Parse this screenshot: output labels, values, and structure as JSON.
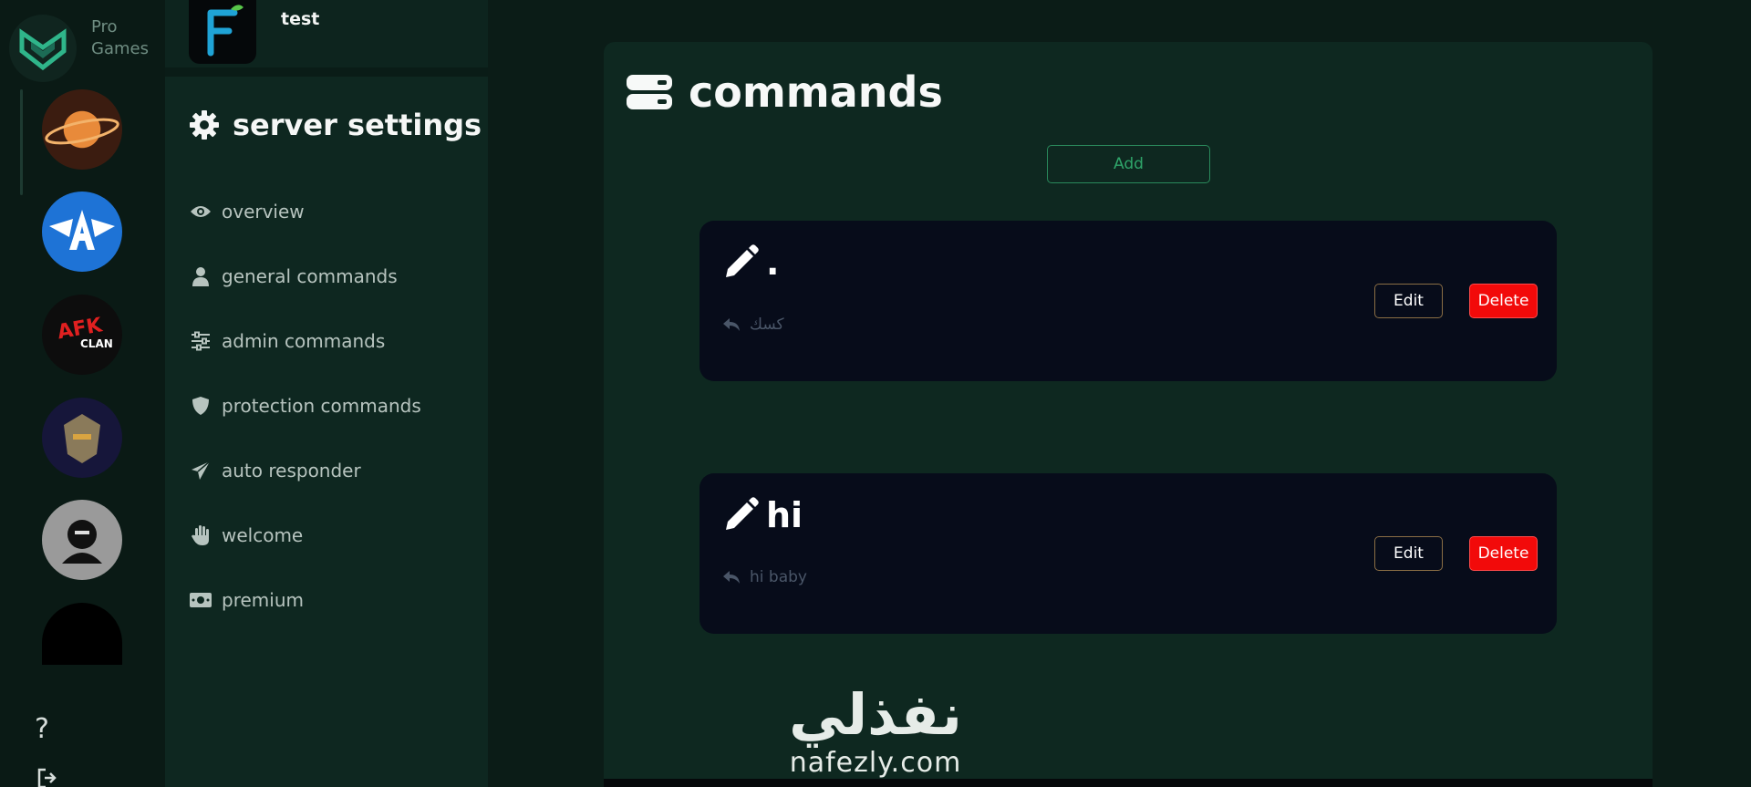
{
  "brand": {
    "line1": "Pro",
    "line2": "Games"
  },
  "servers": [
    "server-planet",
    "server-wings-a",
    "server-afk-clan",
    "server-knight",
    "server-unknown-team",
    "server-dark"
  ],
  "rail": {
    "help_label": "?"
  },
  "guild": {
    "name": "test"
  },
  "sidebar": {
    "title": "server settings",
    "items": [
      {
        "label": "overview",
        "icon": "eye-icon"
      },
      {
        "label": "general commands",
        "icon": "user-icon"
      },
      {
        "label": "admin commands",
        "icon": "sliders-icon"
      },
      {
        "label": "protection commands",
        "icon": "shield-icon"
      },
      {
        "label": "auto responder",
        "icon": "paper-plane-icon"
      },
      {
        "label": "welcome",
        "icon": "hand-icon"
      },
      {
        "label": "premium",
        "icon": "money-icon"
      }
    ]
  },
  "main": {
    "title": "commands",
    "add_label": "Add",
    "commands": [
      {
        "name": ".",
        "reply": "كسك",
        "edit_label": "Edit",
        "delete_label": "Delete"
      },
      {
        "name": "hi",
        "reply": "hi baby",
        "edit_label": "Edit",
        "delete_label": "Delete"
      }
    ]
  },
  "watermark": {
    "arabic": "نفذلي",
    "latin": "nafezly.com"
  },
  "colors": {
    "background": "#0b1c17",
    "sidebar": "#0e2720",
    "panel": "#0e2820",
    "card": "#070c1a",
    "accent_green": "#2fa56a",
    "delete_red": "#f20a0a"
  }
}
